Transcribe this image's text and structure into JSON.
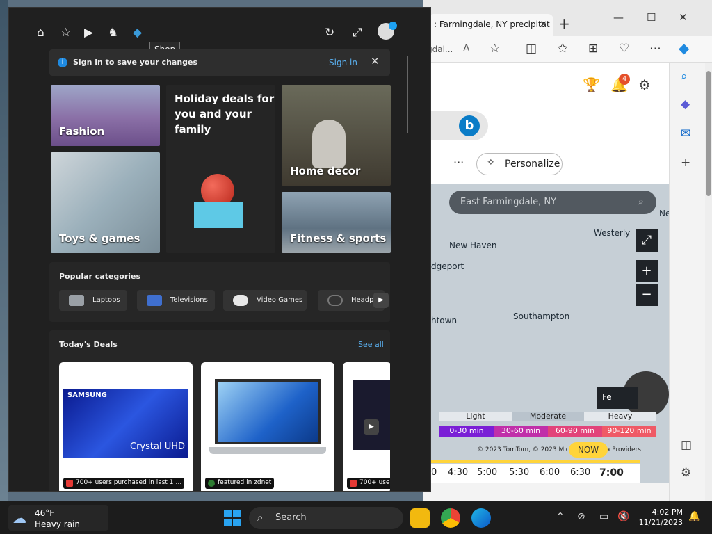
{
  "browser": {
    "tab_title": ": Farmingdale, NY precipitat",
    "address_fragment": "gdal...",
    "notification_count": "4",
    "personalize_label": "Personalize",
    "more_label": "···",
    "map": {
      "search_placeholder": "East Farmingdale, NY",
      "places": [
        "New Haven",
        "Westerly",
        "dgeport",
        "Southampton",
        "htown",
        "Ne"
      ],
      "legend_levels": [
        "Light",
        "Moderate",
        "Heavy"
      ],
      "legend_times": [
        "0-30 min",
        "30-60 min",
        "60-90 min",
        "90-120 min"
      ],
      "copyright": "© 2023 TomTom, © 2023 Micros… n| Data Providers",
      "now_label": "NOW",
      "timeline": [
        "0",
        "4:30",
        "5:00",
        "5:30",
        "6:00",
        "6:30",
        "7:00"
      ],
      "fe_label": "Fe"
    }
  },
  "shop": {
    "tooltip": "Shop",
    "signin_message": "Sign in to save your changes",
    "signin_link": "Sign in",
    "tiles": {
      "fashion": "Fashion",
      "holiday": "Holiday deals for you and your family",
      "home_decor": "Home decor",
      "toys": "Toys & games",
      "fitness": "Fitness & sports"
    },
    "popular_title": "Popular categories",
    "categories": [
      "Laptops",
      "Televisions",
      "Video Games",
      "Headph…"
    ],
    "deals_title": "Today's Deals",
    "see_all": "See all",
    "deals": [
      {
        "brand": "SAMSUNG",
        "product_text": "Crystal UHD",
        "tag": "700+ users purchased in last 1 …"
      },
      {
        "tag": "featured in zdnet"
      },
      {
        "tag": "700+ use"
      }
    ]
  },
  "taskbar": {
    "temperature": "46°F",
    "condition": "Heavy rain",
    "search_label": "Search",
    "time": "4:02 PM",
    "date": "11/21/2023"
  },
  "colors": {
    "accent": "#3a9ad9",
    "shop_bg": "#202020",
    "legend": [
      "#7a1fd6",
      "#c02fa9",
      "#e2437a",
      "#ef5a66"
    ]
  }
}
